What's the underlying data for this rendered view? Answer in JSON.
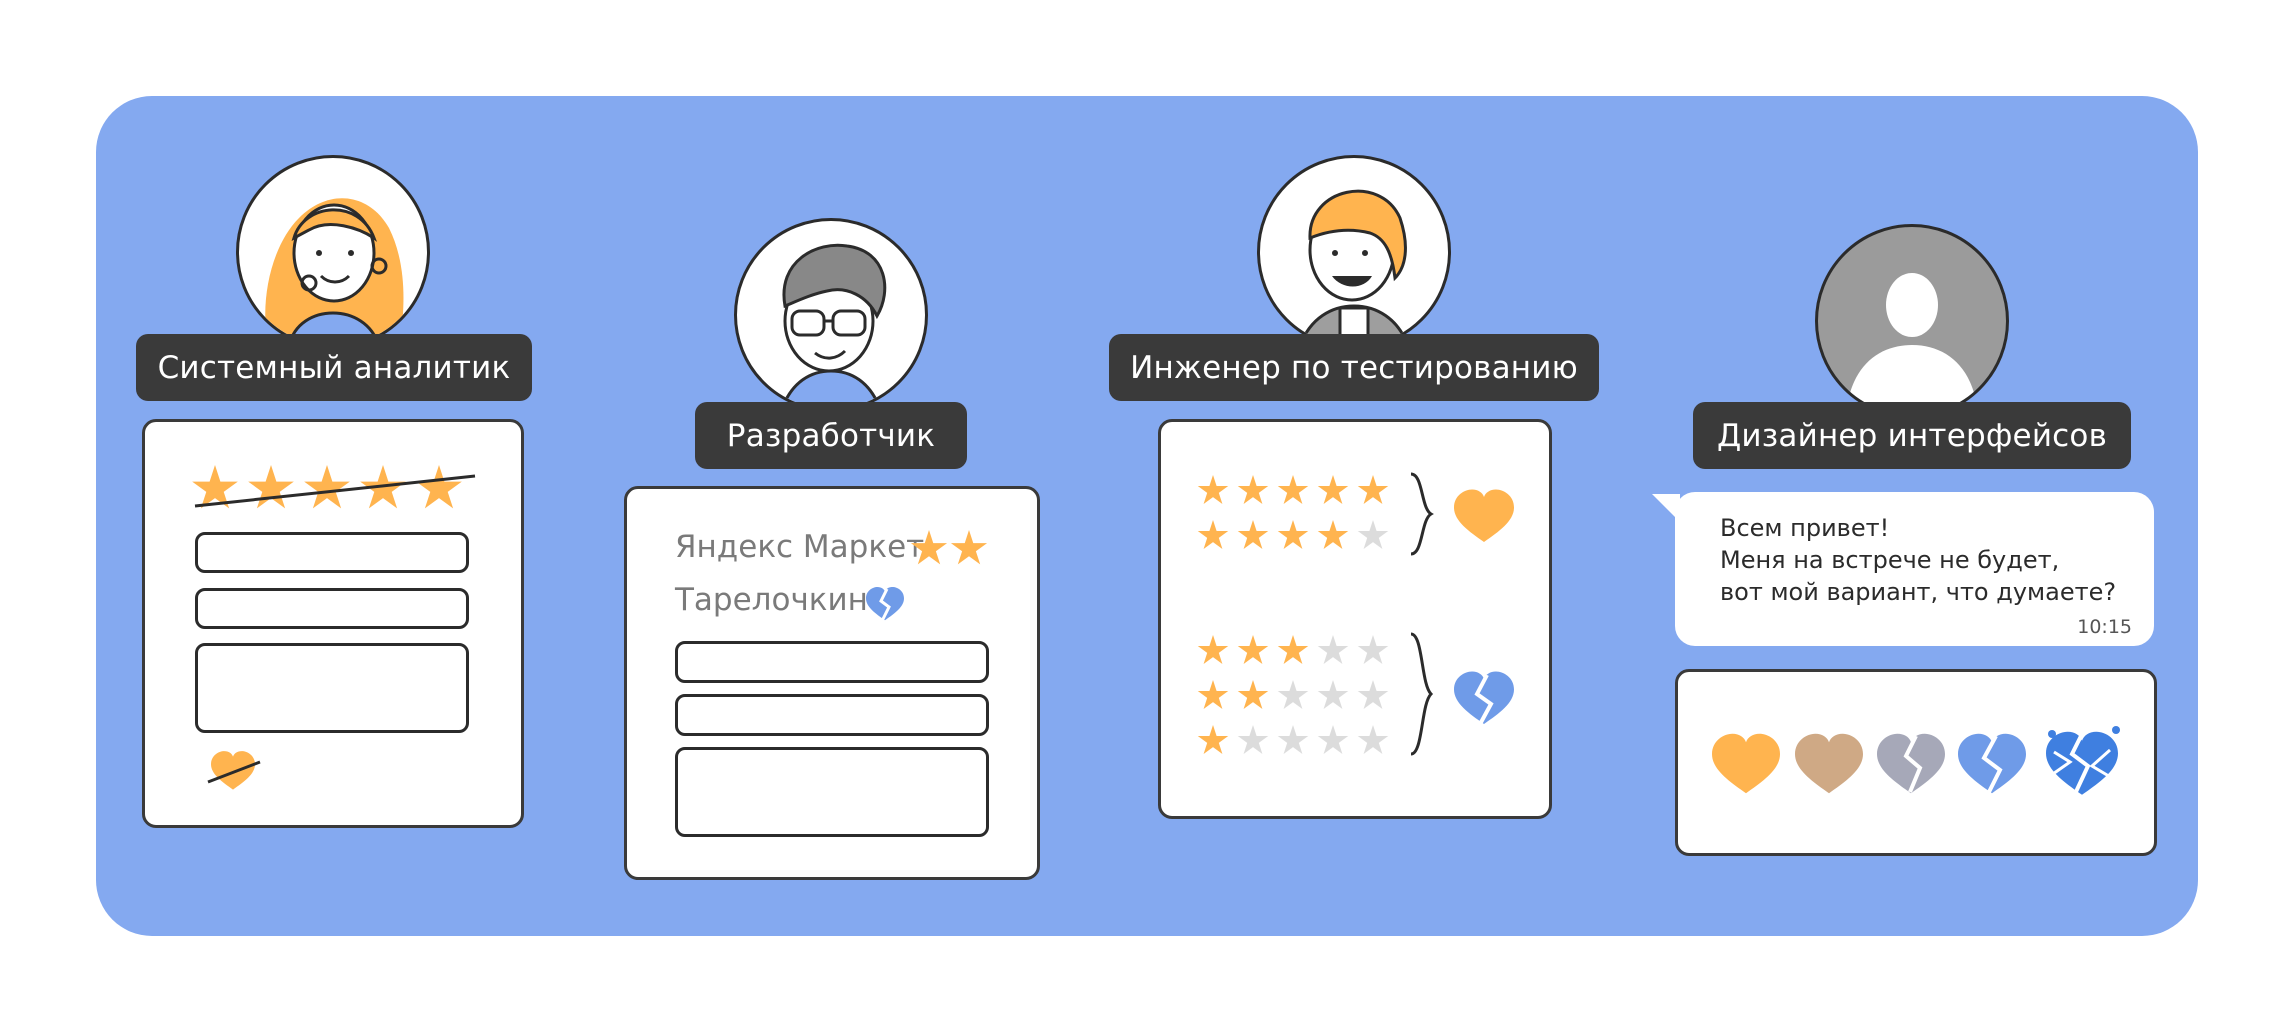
{
  "roles": [
    {
      "title": "Системный аналитик"
    },
    {
      "title": "Разработчик"
    },
    {
      "title": "Инженер по тестированию"
    },
    {
      "title": "Дизайнер интерфейсов"
    }
  ],
  "developer_card": {
    "items": [
      {
        "name": "Яндекс Маркет",
        "stars": 2
      },
      {
        "name": "Тарелочкин",
        "icon": "broken-heart-icon"
      }
    ]
  },
  "tester_card": {
    "high_group": {
      "ratings": [
        5,
        4
      ],
      "result_icon": "heart-icon"
    },
    "low_group": {
      "ratings": [
        3,
        2,
        1
      ],
      "result_icon": "broken-heart-icon"
    }
  },
  "message": {
    "lines": [
      "Всем привет!",
      "Меня на встрече не будет,",
      "вот мой вариант, что думаете?"
    ],
    "time": "10:15"
  },
  "reaction_icons": [
    "heart-icon",
    "heart-icon",
    "broken-heart-icon",
    "broken-heart-icon",
    "shattered-heart-icon"
  ],
  "colors": {
    "panel": "#84a9f0",
    "accent_orange": "#ffb44f",
    "blue": "#6f9be8",
    "label_bg": "#3a3a3a"
  }
}
